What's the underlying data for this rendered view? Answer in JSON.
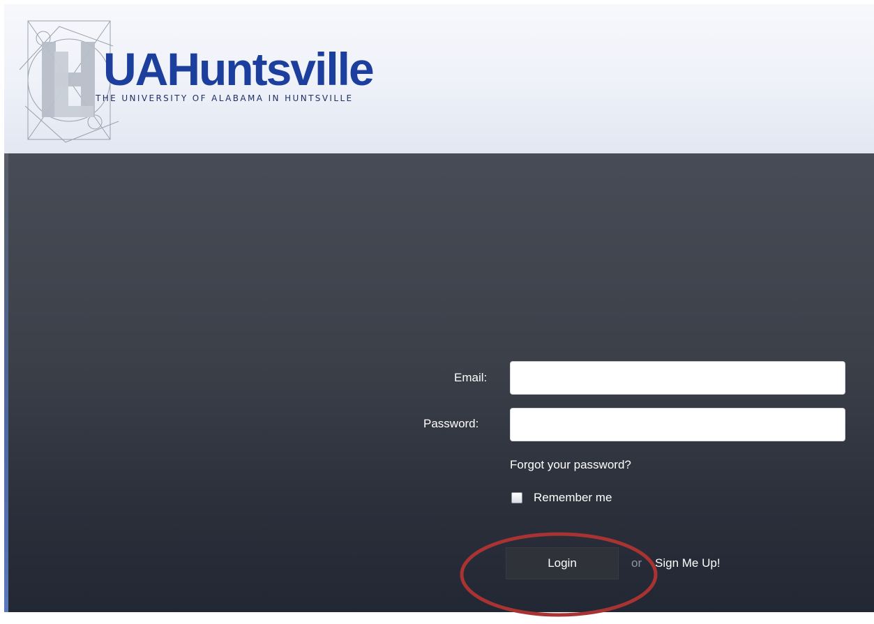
{
  "header": {
    "logo_text": "UAHuntsville",
    "logo_subtext": "THE UNIVERSITY OF ALABAMA IN HUNTSVILLE"
  },
  "login_form": {
    "email_label": "Email:",
    "email_value": "",
    "password_label": "Password:",
    "password_value": "",
    "forgot_password": "Forgot your password?",
    "remember_me": "Remember me",
    "remember_checked": false,
    "login_button": "Login",
    "or_text": "or",
    "signup_link": "Sign Me Up!"
  },
  "colors": {
    "header_background": "#eef1f8",
    "logo_blue": "#1c3e9c",
    "panel_dark": "#2a2f3a",
    "annotation_red": "#a83333"
  }
}
